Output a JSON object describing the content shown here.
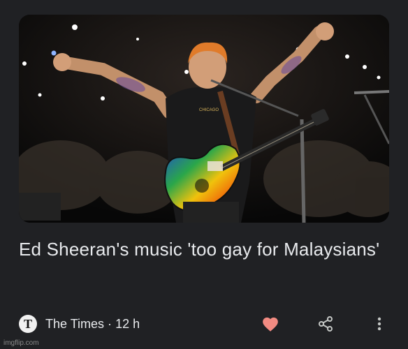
{
  "card": {
    "image_alt": "Ed Sheeran performing on stage with guitar",
    "shirt_text": "CHICAGO",
    "headline": "Ed Sheeran's music 'too gay for Malaysians'",
    "publisher": {
      "logo_letter": "T",
      "name": "The Times",
      "separator": "·",
      "age": "12 h"
    },
    "actions": {
      "like_icon": "heart-icon",
      "share_icon": "share-icon",
      "more_icon": "more-vert-icon"
    }
  },
  "watermark": "imgflip.com",
  "colors": {
    "background": "#202124",
    "text": "#e8eaed",
    "heart": "#f28b82",
    "icon": "#c4c7c5"
  }
}
